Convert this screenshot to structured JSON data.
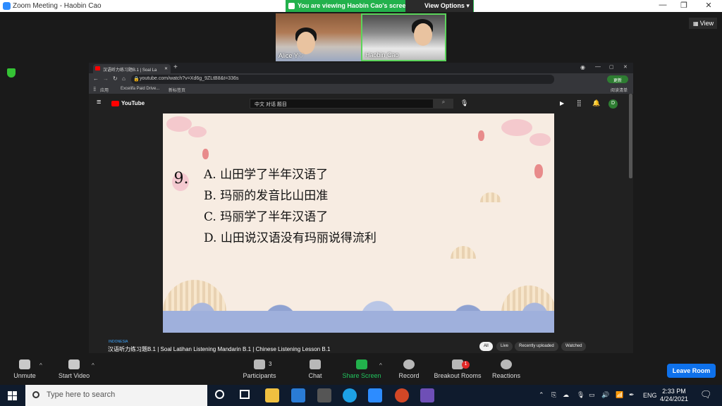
{
  "window": {
    "title": "Zoom Meeting - Haobin Cao",
    "minimize": "—",
    "restore": "❐",
    "close": "✕"
  },
  "share_banner": {
    "text": "You are viewing Haobin Cao's screen",
    "view_options": "View Options",
    "view_options_caret": "▾"
  },
  "view_button": {
    "label": "View"
  },
  "participants_thumbs": [
    {
      "name": "Alice Y♡"
    },
    {
      "name": "Haobin Cao"
    }
  ],
  "browser": {
    "tab_title": "汉语听力练习题B.1 | Soal La",
    "tab_close": "✕",
    "new_tab": "+",
    "url": "youtube.com/watch?v=Xd6g_9ZLtB8&t=336s",
    "update_btn": "更新",
    "bookmarks": [
      "应用",
      "Excelifa Paid Drive...",
      "新标签页"
    ],
    "reading_list": "阅读清单"
  },
  "youtube": {
    "logo": "YouTube",
    "search_value": "中文 对话 题目",
    "avatar_letter": "D",
    "video": {
      "question_number": "9.",
      "options": [
        "A. 山田学了半年汉语了",
        "B. 玛丽的发音比山田准",
        "C. 玛丽学了半年汉语了",
        "D. 山田说汉语没有玛丽说得流利"
      ]
    },
    "country_tag": "INDONESIA",
    "video_title": "汉语听力练习题B.1 | Soal Latihan Listening Mandarin B.1 | Chinese Listening Lesson B.1",
    "chips": [
      "All",
      "Live",
      "Recently uploaded",
      "Watched"
    ]
  },
  "toolbar": {
    "unmute": "Unmute",
    "start_video": "Start Video",
    "participants": "Participants",
    "participants_count": "3",
    "chat": "Chat",
    "share_screen": "Share Screen",
    "record": "Record",
    "breakout_rooms": "Breakout Rooms",
    "breakout_badge": "1",
    "reactions": "Reactions",
    "leave_room": "Leave Room",
    "caret": "^"
  },
  "taskbar": {
    "search_placeholder": "Type here to search",
    "language": "ENG",
    "time": "2:33 PM",
    "date": "4/24/2021"
  },
  "colors": {
    "zoom_blue": "#0e71eb",
    "share_green": "#22b14c",
    "youtube_red": "#ff0000"
  }
}
